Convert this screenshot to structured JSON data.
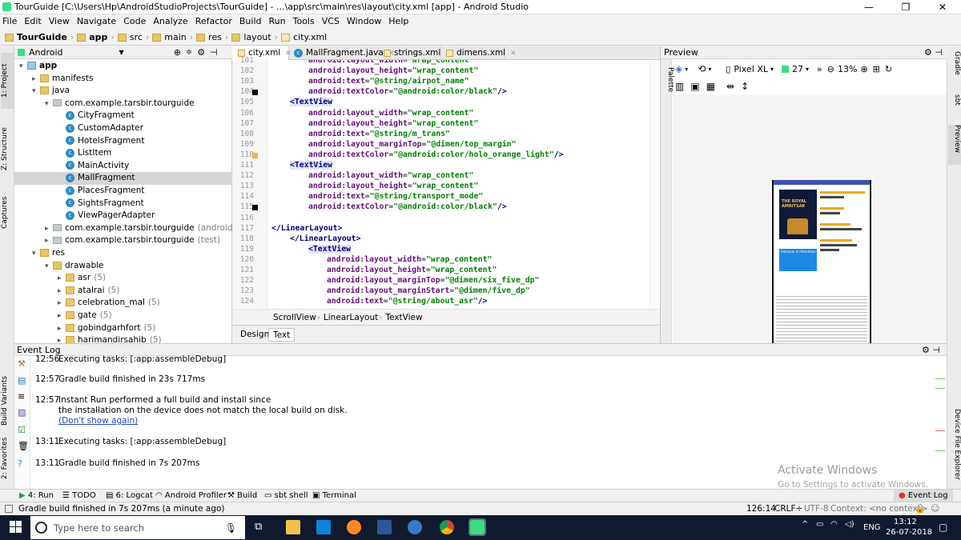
{
  "window": {
    "title": "TourGuide [C:\\Users\\Hp\\AndroidStudioProjects\\TourGuide] - ...\\app\\src\\main\\res\\layout\\city.xml [app] - Android Studio",
    "minimize": "—",
    "maximize": "❐",
    "close": "✕"
  },
  "menu": [
    "File",
    "Edit",
    "View",
    "Navigate",
    "Code",
    "Analyze",
    "Refactor",
    "Build",
    "Run",
    "Tools",
    "VCS",
    "Window",
    "Help"
  ],
  "breadcrumb": [
    "TourGuide",
    "app",
    "src",
    "main",
    "res",
    "layout",
    "city.xml"
  ],
  "toolbar": {
    "run_config": "app"
  },
  "left_strip": {
    "project": "1: Project",
    "structure": "Z: Structure",
    "captures": "Captures",
    "build_variants": "Build Variants",
    "favorites": "2: Favorites"
  },
  "right_strip": {
    "gradle": "Gradle",
    "sbt": "sbt",
    "preview": "Preview",
    "device_explorer": "Device File Explorer"
  },
  "project": {
    "view_mode": "Android",
    "tree": [
      {
        "label": "app",
        "indent": 0,
        "arrow": "▾",
        "kind": "folder",
        "bold": true
      },
      {
        "label": "manifests",
        "indent": 1,
        "arrow": "▸",
        "kind": "folder"
      },
      {
        "label": "java",
        "indent": 1,
        "arrow": "▾",
        "kind": "folder"
      },
      {
        "label": "com.example.tarsbir.tourguide",
        "indent": 2,
        "arrow": "▾",
        "kind": "package"
      },
      {
        "label": "CityFragment",
        "indent": 3,
        "kind": "class"
      },
      {
        "label": "CustomAdapter",
        "indent": 3,
        "kind": "class"
      },
      {
        "label": "HotelsFragment",
        "indent": 3,
        "kind": "class"
      },
      {
        "label": "ListItem",
        "indent": 3,
        "kind": "class"
      },
      {
        "label": "MainActivity",
        "indent": 3,
        "kind": "class"
      },
      {
        "label": "MallFragment",
        "indent": 3,
        "kind": "class",
        "selected": true
      },
      {
        "label": "PlacesFragment",
        "indent": 3,
        "kind": "class"
      },
      {
        "label": "SightsFragment",
        "indent": 3,
        "kind": "class"
      },
      {
        "label": "ViewPagerAdapter",
        "indent": 3,
        "kind": "class"
      },
      {
        "label": "com.example.tarsbir.tourguide",
        "suffix": "(androidTest)",
        "indent": 2,
        "arrow": "▸",
        "kind": "package"
      },
      {
        "label": "com.example.tarsbir.tourguide",
        "suffix": "(test)",
        "indent": 2,
        "arrow": "▸",
        "kind": "package"
      },
      {
        "label": "res",
        "indent": 1,
        "arrow": "▾",
        "kind": "folder"
      },
      {
        "label": "drawable",
        "indent": 2,
        "arrow": "▾",
        "kind": "folder"
      },
      {
        "label": "asr",
        "suffix": "(5)",
        "indent": 3,
        "arrow": "▸",
        "kind": "folder"
      },
      {
        "label": "atalrai",
        "suffix": "(5)",
        "indent": 3,
        "arrow": "▸",
        "kind": "folder"
      },
      {
        "label": "celebration_mal",
        "suffix": "(5)",
        "indent": 3,
        "arrow": "▸",
        "kind": "folder"
      },
      {
        "label": "gate",
        "suffix": "(5)",
        "indent": 3,
        "arrow": "▸",
        "kind": "folder"
      },
      {
        "label": "gobindgarhfort",
        "suffix": "(5)",
        "indent": 3,
        "arrow": "▸",
        "kind": "folder"
      },
      {
        "label": "harimandirsahib",
        "suffix": "(5)",
        "indent": 3,
        "arrow": "▸",
        "kind": "folder"
      }
    ]
  },
  "editor": {
    "tabs": [
      {
        "label": "city.xml",
        "active": true
      },
      {
        "label": "MallFragment.java"
      },
      {
        "label": "strings.xml"
      },
      {
        "label": "dimens.xml"
      }
    ],
    "lines": [
      {
        "n": "101",
        "indent": 2,
        "attr": "android:layout_width",
        "val": "\"wrap_content\""
      },
      {
        "n": "102",
        "indent": 2,
        "attr": "android:layout_height",
        "val": "\"wrap_content\""
      },
      {
        "n": "103",
        "indent": 2,
        "attr": "android:text",
        "val": "\"@string/airpot_name\""
      },
      {
        "n": "104",
        "indent": 2,
        "attr": "android:textColor",
        "val": "\"@android:color/black\"",
        "end": "/>",
        "marker": "black"
      },
      {
        "n": "105",
        "indent": 1,
        "tag": "<TextView"
      },
      {
        "n": "106",
        "indent": 2,
        "attr": "android:layout_width",
        "val": "\"wrap_content\""
      },
      {
        "n": "107",
        "indent": 2,
        "attr": "android:layout_height",
        "val": "\"wrap_content\""
      },
      {
        "n": "108",
        "indent": 2,
        "attr": "android:text",
        "val": "\"@string/m_trans\""
      },
      {
        "n": "109",
        "indent": 2,
        "attr": "android:layout_marginTop",
        "val": "\"@dimen/top_margin\""
      },
      {
        "n": "110",
        "indent": 2,
        "attr": "android:textColor",
        "val": "\"@android:color/holo_orange_light\"",
        "end": "/>",
        "marker": "orange"
      },
      {
        "n": "111",
        "indent": 1,
        "tag": "<TextView"
      },
      {
        "n": "112",
        "indent": 2,
        "attr": "android:layout_width",
        "val": "\"wrap_content\""
      },
      {
        "n": "113",
        "indent": 2,
        "attr": "android:layout_height",
        "val": "\"wrap_content\""
      },
      {
        "n": "114",
        "indent": 2,
        "attr": "android:text",
        "val": "\"@string/transport_mode\""
      },
      {
        "n": "115",
        "indent": 2,
        "attr": "android:textColor",
        "val": "\"@android:color/black\"",
        "end": "/>",
        "marker": "black"
      },
      {
        "n": "116",
        "indent": 0,
        "tag": ""
      },
      {
        "n": "117",
        "indent": 0,
        "tag": "</LinearLayout>"
      },
      {
        "n": "118",
        "indent": 1,
        "tag": "</LinearLayout>"
      },
      {
        "n": "119",
        "indent": 2,
        "tag": "<TextView"
      },
      {
        "n": "120",
        "indent": 3,
        "attr": "android:layout_width",
        "val": "\"wrap_content\""
      },
      {
        "n": "121",
        "indent": 3,
        "attr": "android:layout_height",
        "val": "\"wrap_content\""
      },
      {
        "n": "122",
        "indent": 3,
        "attr": "android:layout_marginTop",
        "val": "\"@dimen/six_five_dp\""
      },
      {
        "n": "123",
        "indent": 3,
        "attr": "android:layout_marginStart",
        "val": "\"@dimen/five_dp\""
      },
      {
        "n": "124",
        "indent": 3,
        "attr": "android:text",
        "val": "\"@string/about_asr\"",
        "end": "/>"
      }
    ],
    "crumbs": [
      "ScrollView",
      "LinearLayout",
      "TextView"
    ],
    "bottom_tabs": {
      "design": "Design",
      "text": "Text"
    }
  },
  "preview": {
    "label": "Preview",
    "palette": "Palette",
    "device": "Pixel XL",
    "api": "27",
    "zoom": "13%",
    "phone_banner": "THE ROYAL AMRITSAR",
    "phone_box": "Famous in Amritsar"
  },
  "event_log": {
    "title": "Event Log",
    "entries": [
      {
        "time": "12:56",
        "text": "Executing tasks: [:app:assembleDebug]"
      },
      {
        "time": "12:57",
        "text": "Gradle build finished in 23s 717ms"
      },
      {
        "time": "12:57",
        "text": "Instant Run performed a full build and install since",
        "text2": "the installation on the device does not match the local build on disk.",
        "link": "(Don't show again)"
      },
      {
        "time": "13:11",
        "text": "Executing tasks: [:app:assembleDebug]"
      },
      {
        "time": "13:11",
        "text": "Gradle build finished in 7s 207ms"
      }
    ],
    "watermark_1": "Activate Windows",
    "watermark_2": "Go to Settings to activate Windows."
  },
  "bottom_tabs": [
    "4: Run",
    "TODO",
    "6: Logcat",
    "Android Profiler",
    "Build",
    "sbt shell",
    "Terminal"
  ],
  "event_log_tab": "Event Log",
  "status": {
    "message": "Gradle build finished in 7s 207ms (a minute ago)",
    "position": "126:14",
    "line_sep": "CRLF÷",
    "encoding": "UTF-8",
    "context": "Context: <no context>"
  },
  "taskbar": {
    "search_placeholder": "Type here to search",
    "lang": "ENG",
    "time": "13:12",
    "date": "26-07-2018"
  },
  "colors": {
    "accent": "#3875d7",
    "taskbar": "#101a2e",
    "selection": "#d5d5d5"
  }
}
